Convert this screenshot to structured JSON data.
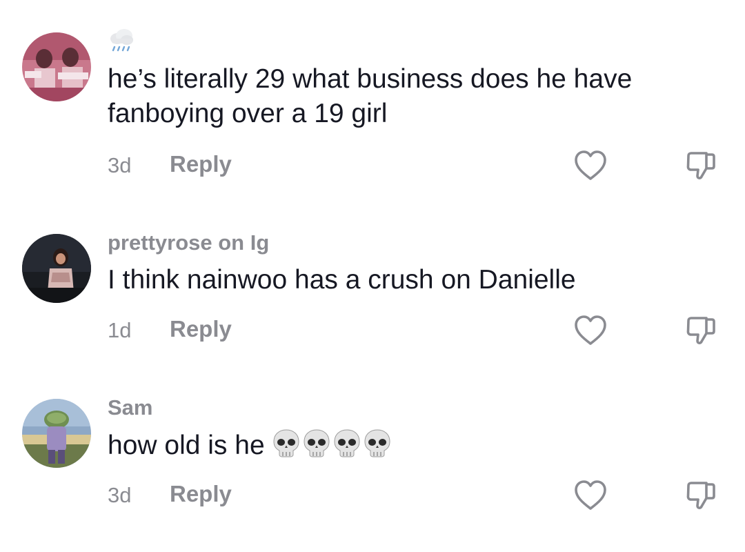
{
  "comments": [
    {
      "username": "",
      "username_icon": "cloud-rain-icon",
      "text": "he’s literally 29 what business does he have fanboying over a 19 girl",
      "time": "3d",
      "reply_label": "Reply"
    },
    {
      "username": "prettyrose on Ig",
      "text": "I think nainwoo has a crush on Danielle",
      "time": "1d",
      "reply_label": "Reply"
    },
    {
      "username": "Sam",
      "text": "how old is he",
      "emoji": [
        "skull-icon",
        "skull-icon",
        "skull-icon",
        "skull-icon"
      ],
      "time": "3d",
      "reply_label": "Reply"
    }
  ],
  "icons": {
    "like": "heart-outline-icon",
    "dislike": "thumbs-down-outline-icon"
  },
  "colors": {
    "text": "#161823",
    "meta": "#8a8b91"
  }
}
